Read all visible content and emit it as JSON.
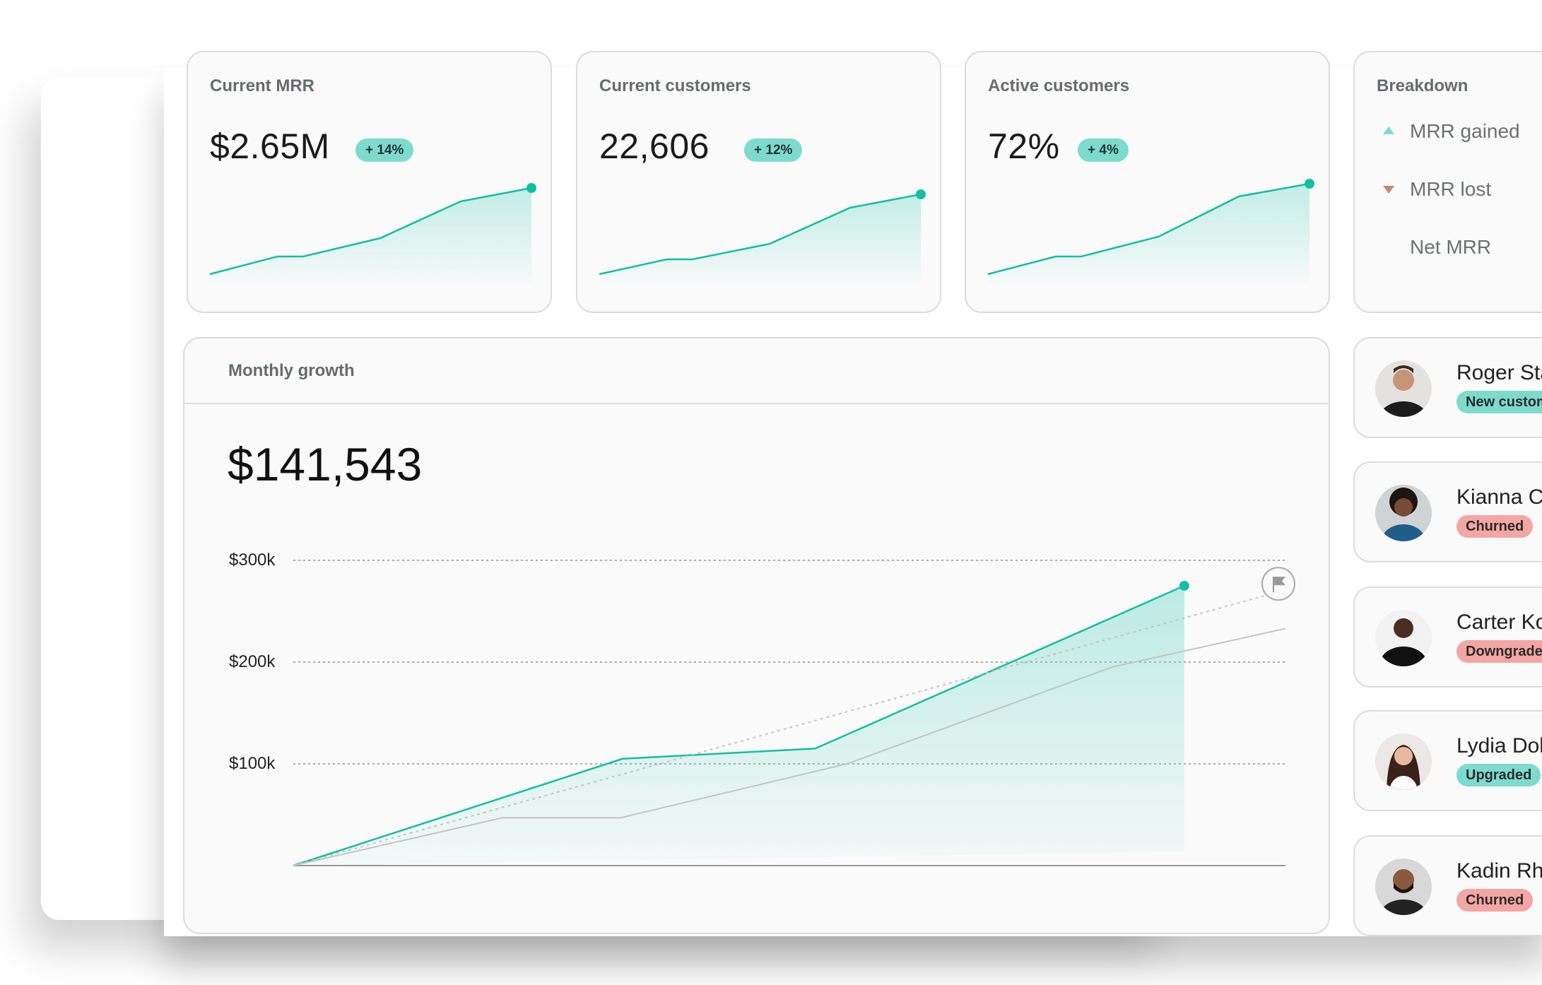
{
  "colors": {
    "accent": "#12bfa2",
    "accent_fill": "#7ddbcd",
    "badge_positive": "#7ddbcd",
    "badge_negative": "#f3a6a3",
    "loss": "#c98470",
    "comparison_line": "#c4c4c4"
  },
  "kpis": [
    {
      "title": "Current MRR",
      "value": "$2.65M",
      "change": "+ 14%",
      "trend": [
        0,
        25,
        25,
        51,
        103,
        122
      ]
    },
    {
      "title": "Current customers",
      "value": "22,606",
      "change": "+ 12%",
      "trend": [
        0,
        21,
        21,
        43,
        94,
        113
      ]
    },
    {
      "title": "Active customers",
      "value": "72%",
      "change": "+ 4%",
      "trend": [
        0,
        25,
        25,
        53,
        110,
        128
      ]
    }
  ],
  "breakdown": {
    "title": "Breakdown",
    "items": [
      {
        "label": "MRR gained",
        "icon": "triangle-up-icon"
      },
      {
        "label": "MRR lost",
        "icon": "triangle-down-icon"
      },
      {
        "label": "Net MRR",
        "icon": ""
      }
    ]
  },
  "growth": {
    "title": "Monthly growth",
    "value": "$141,543"
  },
  "chart_data": {
    "type": "line",
    "title": "Monthly growth",
    "ylim": [
      0,
      300000
    ],
    "yticks": [
      100000,
      200000,
      300000
    ],
    "ytick_labels": [
      "$100k",
      "$200k",
      "$300k"
    ],
    "grid": true,
    "series": [
      {
        "name": "current",
        "style": "solid-area",
        "color": "#12bfa2",
        "points": [
          [
            0,
            0
          ],
          [
            0.332,
            105000
          ],
          [
            0.526,
            115000
          ],
          [
            0.898,
            275000
          ]
        ]
      },
      {
        "name": "previous",
        "style": "solid",
        "color": "#c4c4c4",
        "points": [
          [
            0,
            0
          ],
          [
            0.211,
            47000
          ],
          [
            0.33,
            47000
          ],
          [
            0.558,
            100000
          ],
          [
            0.825,
            195000
          ],
          [
            1.0,
            233000
          ]
        ]
      },
      {
        "name": "target",
        "style": "dotted",
        "color": "#c4c4c4",
        "points": [
          [
            0,
            0
          ],
          [
            0.978,
            265000
          ]
        ]
      }
    ],
    "annotation": {
      "icon": "flag-icon",
      "at": [
        1.0,
        270000
      ]
    }
  },
  "customers": [
    {
      "name": "Roger Sta",
      "status": "New customer",
      "tone": "positive"
    },
    {
      "name": "Kianna Cu",
      "status": "Churned",
      "tone": "negative"
    },
    {
      "name": "Carter Ko",
      "status": "Downgraded",
      "tone": "negative"
    },
    {
      "name": "Lydia Dok",
      "status": "Upgraded",
      "tone": "positive"
    },
    {
      "name": "Kadin Rhi",
      "status": "Churned",
      "tone": "negative"
    }
  ]
}
